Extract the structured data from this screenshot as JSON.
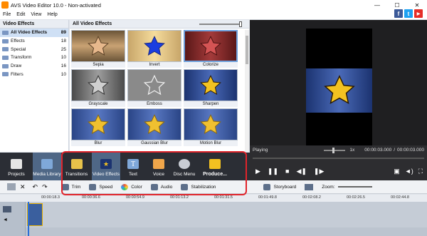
{
  "window": {
    "title": "AVS Video Editor 10.0 - Non-activated"
  },
  "menu": [
    "File",
    "Edit",
    "View",
    "Help"
  ],
  "social": [
    {
      "label": "f",
      "color": "#3b5998"
    },
    {
      "label": "t",
      "color": "#1da1f2"
    },
    {
      "label": "▶",
      "color": "#e52d27"
    }
  ],
  "left_panel": {
    "header": "Video Effects",
    "categories": [
      {
        "name": "All Video Effects",
        "count": "89"
      },
      {
        "name": "Effects",
        "count": "18"
      },
      {
        "name": "Special",
        "count": "25"
      },
      {
        "name": "Transform",
        "count": "10"
      },
      {
        "name": "Draw",
        "count": "16"
      },
      {
        "name": "Filters",
        "count": "10"
      }
    ]
  },
  "effects_panel": {
    "header": "All Video Effects",
    "effects": [
      "Sepia",
      "Invert",
      "Colorize",
      "Grayscale",
      "Emboss",
      "Sharpen",
      "Blur",
      "Gaussian Blur",
      "Motion Blur"
    ]
  },
  "preview": {
    "status": "Playing",
    "speed": "1x",
    "time_current": "00:00:03.000",
    "time_total": "00:00:03.000",
    "separator": "/"
  },
  "main_toolbar": [
    "Projects",
    "Media Library",
    "Transitions",
    "Video Effects",
    "Text",
    "Voice",
    "Disc Menu",
    "Produce..."
  ],
  "edit_tools": [
    "Trim",
    "Speed",
    "Color",
    "Audio",
    "Stabilization"
  ],
  "timeline_view": {
    "storyboard": "Storyboard",
    "zoom": "Zoom:"
  },
  "ruler_ticks": [
    "00:00:18.3",
    "00:00:36.6",
    "00:00:54.9",
    "00:01:13.2",
    "00:01:31.5",
    "00:01:49.8",
    "00:02:08.2",
    "00:02:26.5",
    "00:02:44.8"
  ],
  "colors": {
    "accent_highlight": "#e0242b",
    "toolbar_bg": "#2b2e35",
    "active_tool": "#4f6786"
  }
}
